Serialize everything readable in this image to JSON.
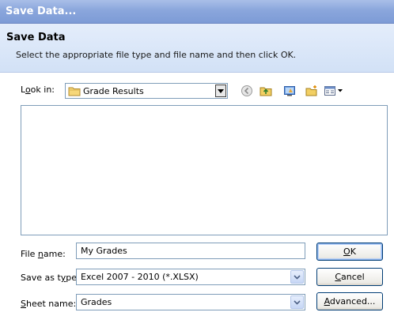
{
  "window": {
    "title": "Save Data..."
  },
  "header": {
    "title": "Save Data",
    "subtitle": "Select the appropriate file type and file name and then click OK."
  },
  "look_in": {
    "label_pre": "L",
    "label_u": "o",
    "label_post": "ok in:",
    "value": "Grade Results",
    "folder_icon": "folder-icon"
  },
  "toolbar": {
    "icons": [
      "back-icon",
      "up-folder-icon",
      "desktop-icon",
      "new-folder-icon",
      "view-menu-icon"
    ]
  },
  "form": {
    "file_name": {
      "label_pre": "File ",
      "label_u": "n",
      "label_post": "ame:",
      "value": "My Grades"
    },
    "save_as_type": {
      "label_pre": "Save as t",
      "label_u": "y",
      "label_post": "pe:",
      "value": "Excel 2007 - 2010 (*.XLSX)"
    },
    "sheet_name": {
      "label_pre": "",
      "label_u": "S",
      "label_post": "heet name:",
      "value": "Grades"
    }
  },
  "buttons": {
    "ok": {
      "u": "O",
      "post": "K"
    },
    "cancel": {
      "u": "C",
      "post": "ancel"
    },
    "advanced": {
      "u": "A",
      "post": "dvanced..."
    }
  },
  "colors": {
    "title_bar": "#8aa6dc",
    "header_bg": "#d2e1f6",
    "field_border": "#7f9db9",
    "button_border": "#003c74"
  }
}
